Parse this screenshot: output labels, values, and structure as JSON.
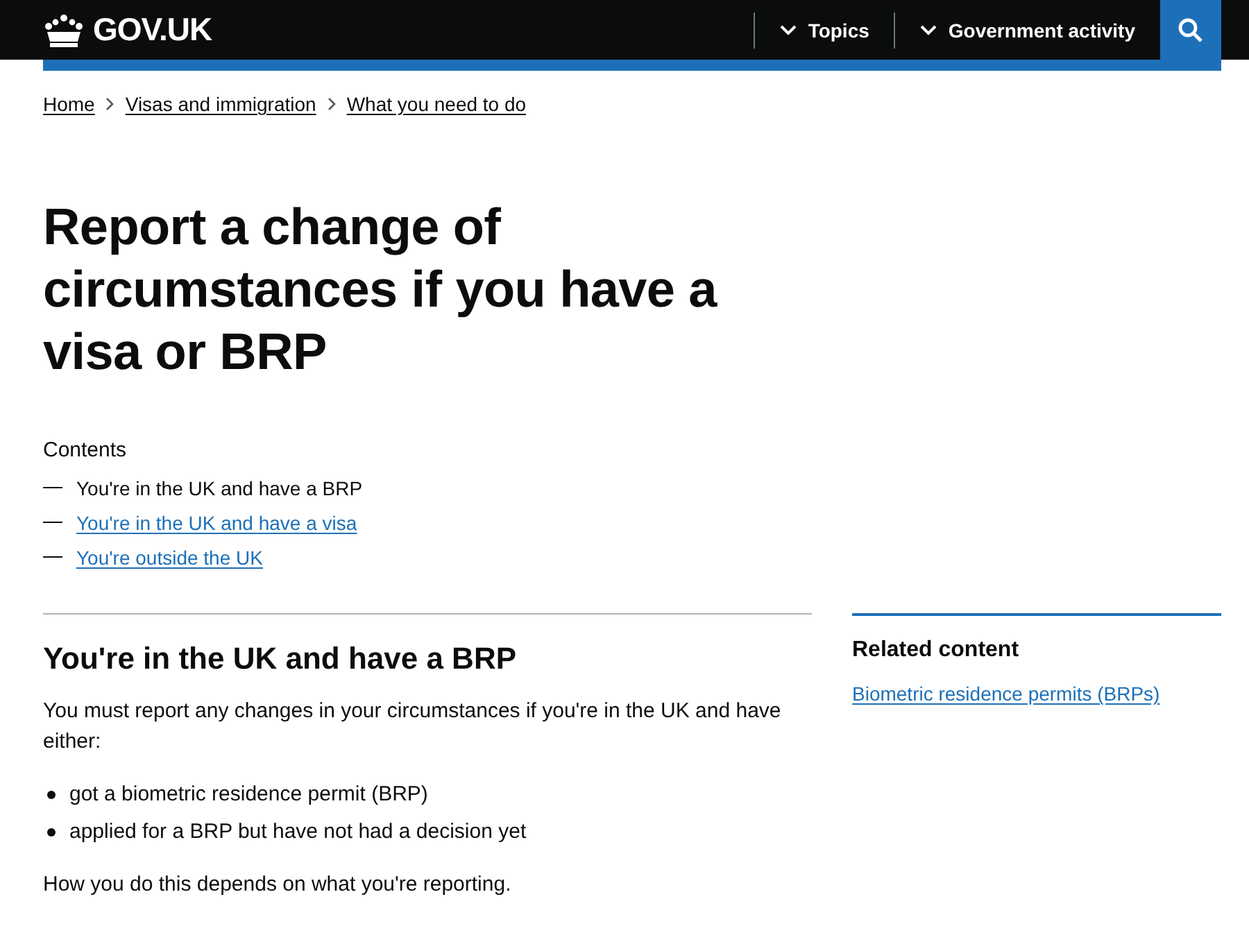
{
  "header": {
    "logo": "GOV.UK",
    "nav": [
      {
        "label": "Topics"
      },
      {
        "label": "Government activity"
      }
    ]
  },
  "breadcrumbs": [
    "Home",
    "Visas and immigration",
    "What you need to do"
  ],
  "title": "Report a change of circumstances if you have a visa or BRP",
  "contents": {
    "heading": "Contents",
    "items": [
      {
        "label": "You're in the UK and have a BRP",
        "selected": true
      },
      {
        "label": "You're in the UK and have a visa",
        "selected": false
      },
      {
        "label": "You're outside the UK",
        "selected": false
      }
    ]
  },
  "section": {
    "heading": "You're in the UK and have a BRP",
    "intro": "You must report any changes in your circumstances if you're in the UK and have either:",
    "bullets": [
      "got a biometric residence permit (BRP)",
      "applied for a BRP but have not had a decision yet"
    ],
    "outro": "How you do this depends on what you're reporting."
  },
  "related": {
    "heading": "Related content",
    "links": [
      "Biometric residence permits (BRPs)"
    ]
  }
}
